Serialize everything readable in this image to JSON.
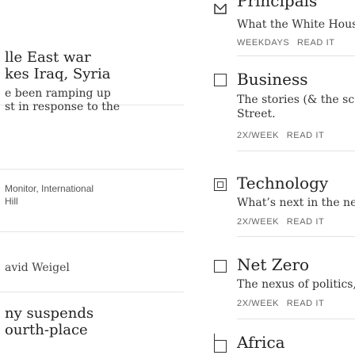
{
  "left_stories": [
    {
      "headline_lines": [
        "lle East war",
        "kes Iraq, Syria"
      ]
    },
    {
      "teaser_lines": [
        "e been ramping up",
        "st in response to the"
      ]
    },
    {
      "author_lines": [
        "Monitor, International",
        "Hill"
      ]
    },
    {
      "author_lines": [
        "avid Weigel"
      ]
    },
    {
      "headline_lines": [
        "ny suspends",
        "ourth-place"
      ]
    }
  ],
  "newsletters": [
    {
      "title": "Principals",
      "description": "What the White House is rea",
      "frequency": "WEEKDAYS",
      "read_label": "READ IT"
    },
    {
      "title": "Business",
      "description_lines": [
        "The stories (& the scoops) fr",
        "Street."
      ],
      "frequency": "2X/WEEK",
      "read_label": "READ IT"
    },
    {
      "title": "Technology",
      "description": "What’s next in the new era o",
      "frequency": "2X/WEEK",
      "read_label": "READ IT"
    },
    {
      "title": "Net Zero",
      "description": "The nexus of politics, tech, a",
      "frequency": "2X/WEEK",
      "read_label": "READ IT"
    },
    {
      "title": "Africa"
    }
  ]
}
